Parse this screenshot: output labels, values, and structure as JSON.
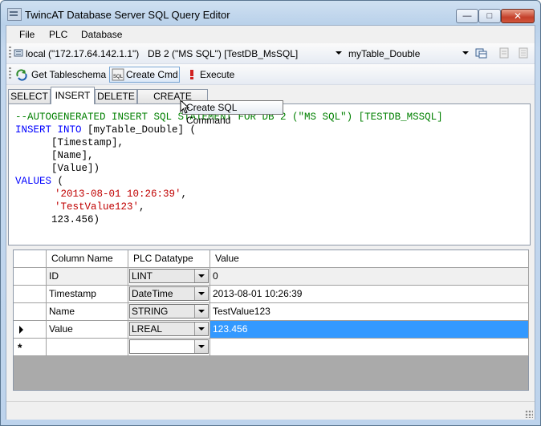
{
  "window": {
    "title": "TwincAT Database Server SQL Query Editor"
  },
  "window_buttons": {
    "minimize": "—",
    "maximize": "□",
    "close": "✕"
  },
  "menu": [
    "File",
    "PLC",
    "Database"
  ],
  "connection_bar": {
    "server": "local (\"172.17.64.142.1.1\")",
    "database": "DB 2 (\"MS SQL\") [TestDB_MsSQL]",
    "table": "myTable_Double"
  },
  "actions": {
    "get_tableschema": "Get Tableschema",
    "create_cmd": "Create Cmd",
    "execute": "Execute"
  },
  "tooltip": "Create SQL Command",
  "tabs": [
    "SELECT",
    "INSERT",
    "DELETE",
    "CREATE TABLE"
  ],
  "active_tab": "INSERT",
  "code": {
    "l1_comment": "--AUTOGENERATED INSERT SQL STATEMENT FOR DB 2 (\"MS SQL\") [TESTDB_MSSQL]",
    "l2_kw": "INSERT INTO",
    "l2_rest": " [myTable_Double] (",
    "l3": "      [Timestamp],",
    "l4": "      [Name],",
    "l5": "      [Value])",
    "l6_kw": "VALUES",
    "l6_rest": " (",
    "l7_str": "'2013-08-01 10:26:39'",
    "l7_rest": ",",
    "l8_str": "'TestValue123'",
    "l8_rest": ",",
    "l9": "      123.456)"
  },
  "grid": {
    "headers": [
      "Column Name",
      "PLC Datatype",
      "Value"
    ],
    "rows": [
      {
        "column": "ID",
        "datatype": "LINT",
        "value": "0"
      },
      {
        "column": "Timestamp",
        "datatype": "DateTime",
        "value": "2013-08-01 10:26:39"
      },
      {
        "column": "Name",
        "datatype": "STRING",
        "value": "TestValue123"
      },
      {
        "column": "Value",
        "datatype": "LREAL",
        "value": "123.456"
      }
    ],
    "new_row_marker": "*"
  },
  "colors": {
    "selection": "#3399ff",
    "comment": "#008000",
    "keyword": "#0000ff",
    "string": "#c00000"
  }
}
